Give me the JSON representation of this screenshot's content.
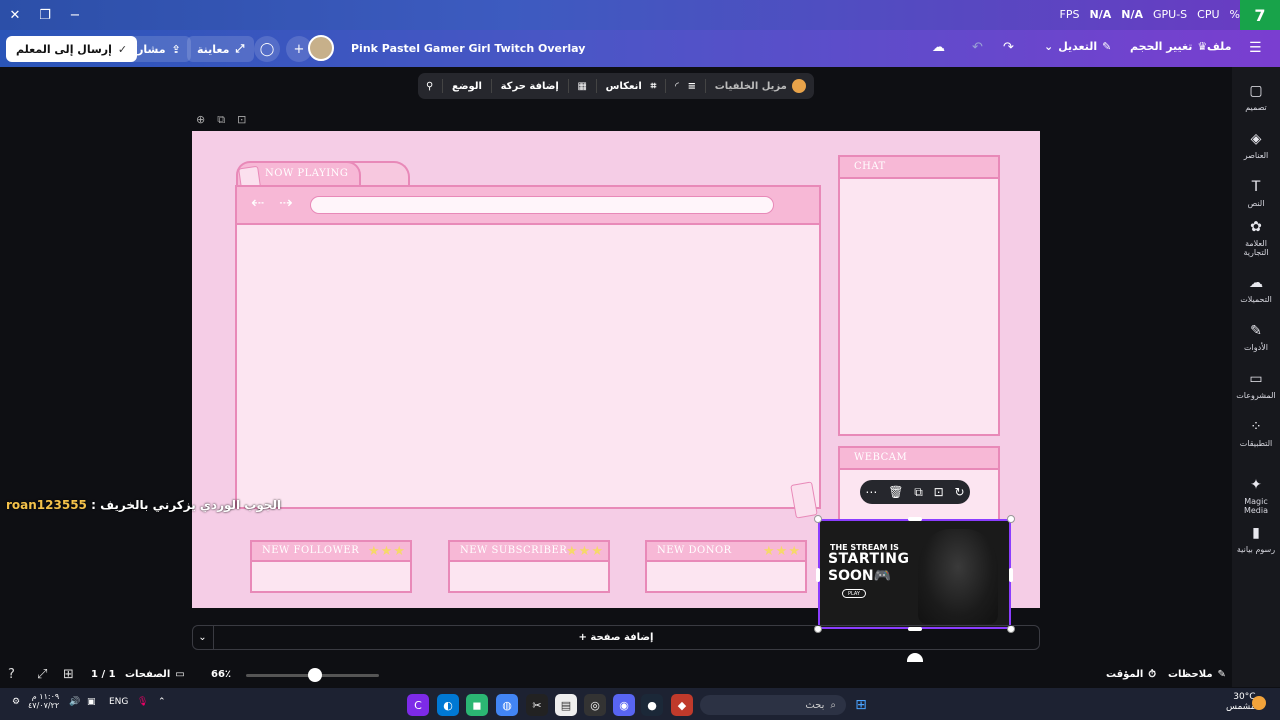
{
  "window": {
    "minimize": "−",
    "restore": "❐",
    "close": "✕"
  },
  "perf": {
    "fps_label": "FPS",
    "fps": "N/A",
    "gpu_value": "N/A",
    "gpu_label": "GPU-S",
    "cpu_label": "CPU",
    "percent": "%",
    "kbadge": "7"
  },
  "topbar": {
    "send_teacher": "إرسال إلى المعلم",
    "share": "مشاركة",
    "preview": "معاينة",
    "doc_title": "Pink Pastel Gamer Girl Twitch Overlay",
    "edit": "التعديل",
    "resize": "تغيير الحجم",
    "file": "ملف"
  },
  "ctxbar": {
    "bg_remover": "مزيل الخلفيات",
    "flip": "انعكاس",
    "animate": "إضافة حركة",
    "position": "الوضع"
  },
  "sidebar": {
    "items": [
      {
        "label": "تصميم",
        "icon": "▢"
      },
      {
        "label": "العناصر",
        "icon": "◈"
      },
      {
        "label": "النص",
        "icon": "T"
      },
      {
        "label": "العلامة التجارية",
        "icon": "✿"
      },
      {
        "label": "التحميلات",
        "icon": "☁"
      },
      {
        "label": "الأدوات",
        "icon": "✎"
      },
      {
        "label": "المشروعات",
        "icon": "▭"
      },
      {
        "label": "التطبيقات",
        "icon": "⁘"
      },
      {
        "label": "Magic Media",
        "icon": "✦"
      },
      {
        "label": "رسوم بيانية",
        "icon": "▮"
      }
    ]
  },
  "overlay": {
    "now_playing": "NOW PLAYING",
    "chat": "CHAT",
    "webcam": "WEBCAM",
    "new_follower": "NEW FOLLOWER",
    "new_subscriber": "NEW SUBSCRIBER",
    "new_donor": "NEW DONOR",
    "stars": "★★★"
  },
  "thumbnail": {
    "line1": "THE STREAM IS",
    "line2": "STARTING",
    "line3": "SOON🎮",
    "play": "PLAY"
  },
  "comment": {
    "user": "roan123555",
    "separator": " : ",
    "text": "الجوب الوردي يزكرني بالخريف"
  },
  "add_page": "+ إضافة صفحة",
  "bottom": {
    "notes": "ملاحظات",
    "timer": "المؤقت",
    "zoom": "66٪",
    "pages_label": "الصفحات",
    "pages": "1 / 1"
  },
  "taskbar": {
    "search_placeholder": "بحث",
    "weather_temp": "30°C",
    "weather_desc": "مشمس",
    "time": "١١:٠٩ م",
    "date": "٤٧/٠٧/٢٢",
    "lang": "ENG"
  }
}
